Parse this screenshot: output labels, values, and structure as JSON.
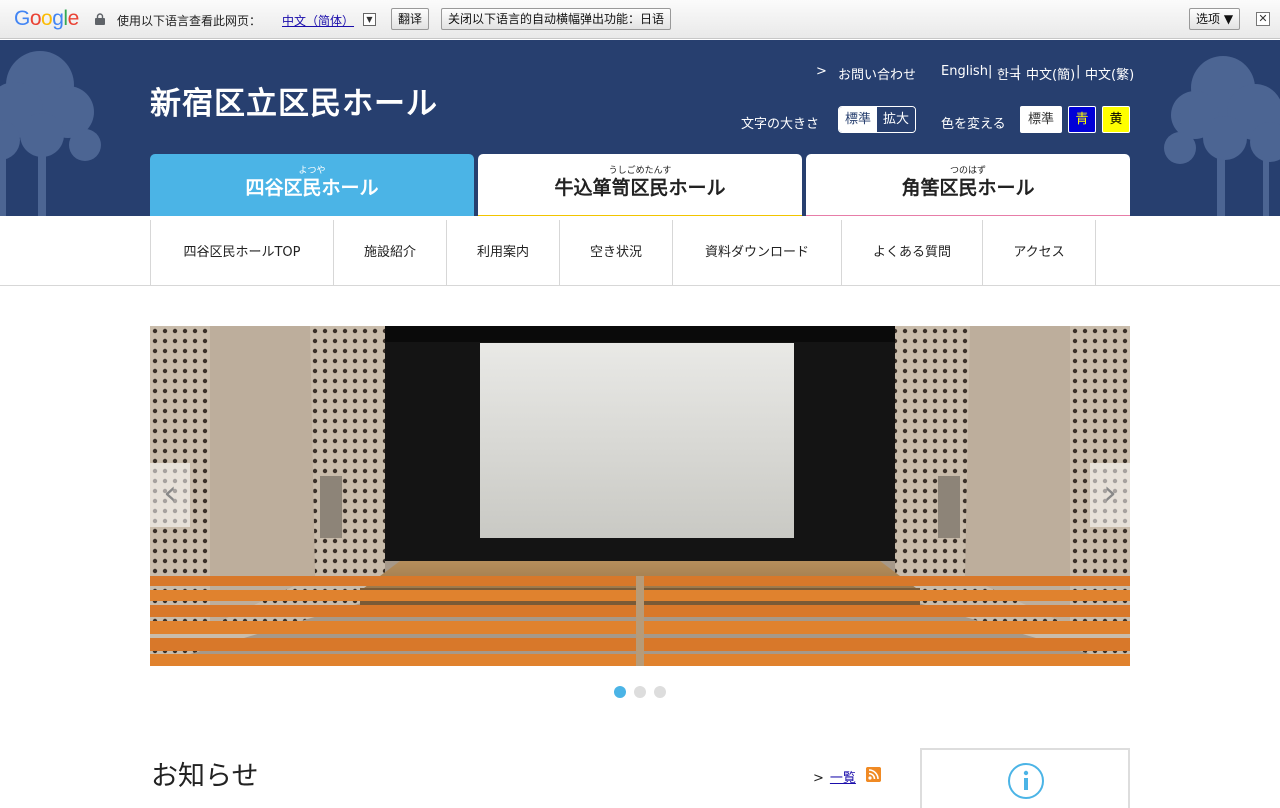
{
  "translate_bar": {
    "logo": "Google",
    "prompt": "使用以下语言查看此网页：",
    "language": "中文（简体）",
    "dropdown_glyph": "▼",
    "translate_button": "翻译",
    "disable_button": "关闭以下语言的自动横幅弹出功能：日语",
    "options_button": "选项 ▼",
    "close_glyph": "✕"
  },
  "header": {
    "site_title": "新宿区立区民ホール",
    "contact_chevron": ">",
    "contact_link": "お問い合わせ",
    "languages": [
      "English",
      "한국",
      "中文(簡)",
      "中文(繁)"
    ],
    "separator": "|",
    "font_size_label": "文字の大きさ",
    "font_size_options": [
      "標準",
      "拡大"
    ],
    "color_label": "色を変える",
    "color_options": [
      "標準",
      "青",
      "黄"
    ]
  },
  "halls": [
    {
      "ruby": "よつや",
      "name": "四谷区民ホール",
      "active": true,
      "color": "#4bb4e6"
    },
    {
      "ruby": "うしごめたんす",
      "name": "牛込箪笥区民ホール",
      "active": false,
      "color": "#f2c500"
    },
    {
      "ruby": "つのはず",
      "name": "角筈区民ホール",
      "active": false,
      "color": "#e77da8"
    }
  ],
  "subnav": [
    "四谷区民ホールTOP",
    "施設紹介",
    "利用案内",
    "空き状況",
    "資料ダウンロード",
    "よくある質問",
    "アクセス"
  ],
  "slider": {
    "prev_glyph": "‹",
    "next_glyph": "›",
    "slide_count": 3,
    "active_index": 0
  },
  "news": {
    "title": "お知らせ",
    "more_chevron": ">",
    "more_link": "一覧"
  },
  "colors": {
    "header_bg": "#273f6f",
    "accent_blue": "#4bb4e6"
  }
}
